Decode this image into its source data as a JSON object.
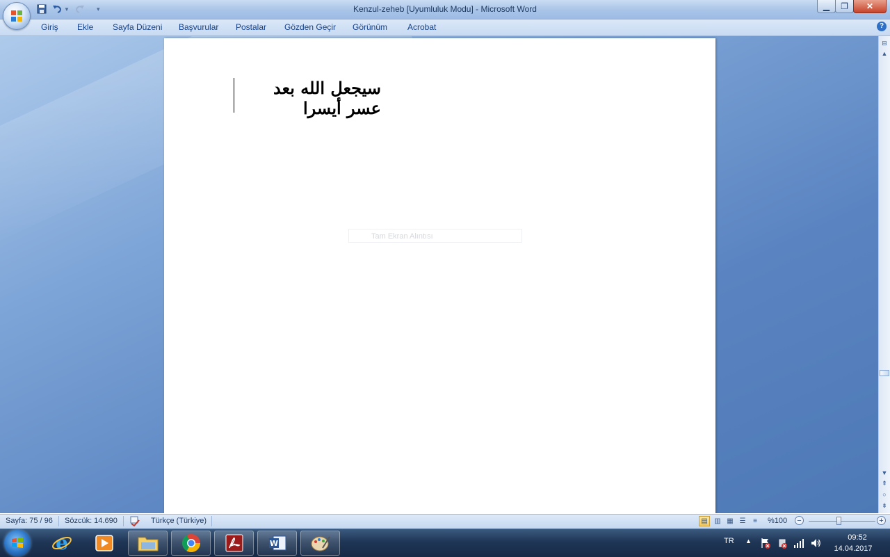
{
  "window": {
    "title": "Kenzul-zeheb [Uyumluluk Modu] - Microsoft Word"
  },
  "ribbon": {
    "tabs": [
      "Giriş",
      "Ekle",
      "Sayfa Düzeni",
      "Başvurular",
      "Postalar",
      "Gözden Geçir",
      "Görünüm",
      "Acrobat"
    ]
  },
  "document": {
    "arabic_text": "سيجعل الله بعد عسر أيسرا",
    "screenshot_hint": "Tam Ekran Alıntısı"
  },
  "status": {
    "page": "Sayfa: 75 / 96",
    "words": "Sözcük: 14.690",
    "language": "Türkçe (Türkiye)",
    "zoom": "%100"
  },
  "taskbar": {
    "apps": [
      "internet-explorer",
      "media-player",
      "file-explorer",
      "chrome",
      "acrobat-reader",
      "word",
      "paint"
    ],
    "language": "TR",
    "time": "09:52",
    "date": "14.04.2017"
  },
  "colors": {
    "ribbon_text": "#15428b",
    "doc_background": "#5a84c1",
    "taskbar": "#1f3656"
  }
}
